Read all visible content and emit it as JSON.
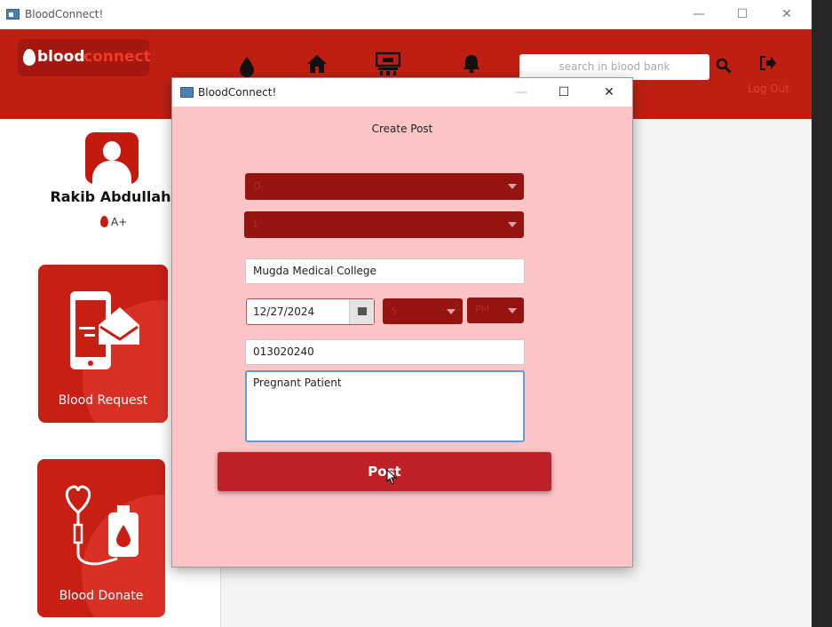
{
  "main_window": {
    "title": "BloodConnect!",
    "controls": {
      "minimize": "—",
      "maximize": "☐",
      "close": "✕"
    }
  },
  "header": {
    "logo_part1": "blood",
    "logo_part2": "connect",
    "nav_icons": [
      "blood-drop-icon",
      "home-icon",
      "hospital-icon",
      "bell-icon"
    ],
    "search_placeholder": "search in blood bank",
    "logout_label": "Log Out",
    "brand_color": "#bf1f12"
  },
  "sidebar": {
    "user_name": "Rakib Abdullah",
    "blood_group": "A+",
    "cards": [
      {
        "label": "Blood Request"
      },
      {
        "label": "Blood Donate"
      }
    ]
  },
  "dialog": {
    "title": "BloodConnect!",
    "heading": "Create Post",
    "combo1_value": "O-",
    "combo2_value": "1",
    "hospital_value": "Mugda Medical College",
    "date_value": "12/27/2024",
    "hour_value": "5",
    "ampm_value": "PM",
    "phone_value": "013020240",
    "description_value": "Pregnant Patient",
    "post_label": "Post",
    "bg_color": "#fec5c7"
  }
}
